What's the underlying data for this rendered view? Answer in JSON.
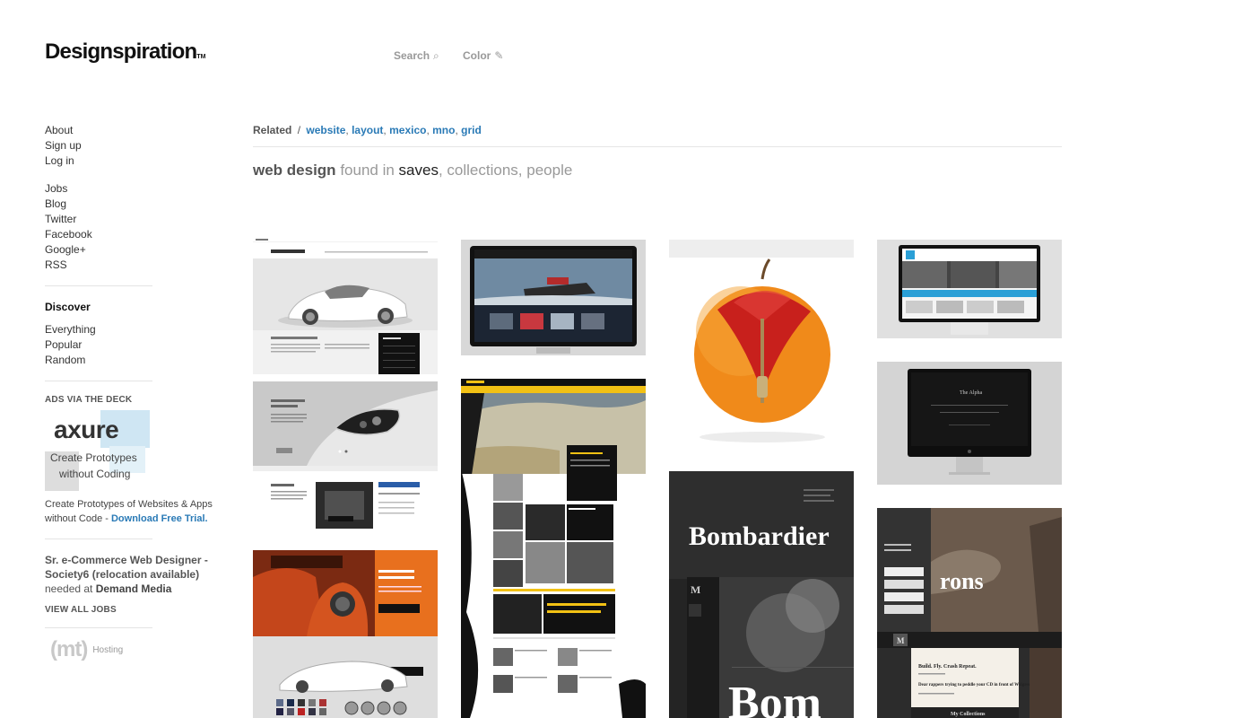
{
  "logo": {
    "text": "Designspiration",
    "tm": "TM"
  },
  "topnav": {
    "search": {
      "label": "Search",
      "icon": "search-icon"
    },
    "color": {
      "label": "Color",
      "icon": "eyedropper-icon"
    }
  },
  "sidebar": {
    "account": [
      "About",
      "Sign up",
      "Log in"
    ],
    "social": [
      "Jobs",
      "Blog",
      "Twitter",
      "Facebook",
      "Google+",
      "RSS"
    ],
    "discover_title": "Discover",
    "discover": [
      "Everything",
      "Popular",
      "Random"
    ],
    "ads_title": "ADS VIA THE DECK",
    "ad": {
      "logo_text": "axure",
      "tagline_1": "Create Prototypes",
      "tagline_2": "without Coding",
      "copy": "Create Prototypes of Websites & Apps without Code - ",
      "link": "Download Free Trial."
    },
    "job": {
      "title": "Sr. e-Commerce Web Designer - Society6 (relocation available)",
      "needed": "needed at ",
      "company": "Demand Media",
      "view_all": "VIEW ALL JOBS"
    },
    "hosting": {
      "logo_text": "(mt)",
      "label": "Hosting"
    }
  },
  "related": {
    "label": "Related",
    "separator": "/",
    "tags": [
      "website",
      "layout",
      "mexico",
      "mno",
      "grid"
    ]
  },
  "results_heading": {
    "query": "web design",
    "found_in": "found in",
    "saves": "saves",
    "collections": "collections",
    "people": "people"
  },
  "tiles": {
    "col1": [
      {
        "subject": "Spyker car website",
        "texts": [
          "SPYKER C8 AILERON",
          "NAVIGATE"
        ]
      },
      {
        "subject": "Spyker headlight page",
        "texts": [
          "EYE-CATCHING HEADLIGHTS",
          "V8 POWER",
          "300",
          "4.5",
          "400"
        ]
      },
      {
        "subject": "Spyker interior page",
        "texts": [
          "WELCOME IN YOUR COCKPIT",
          "NAVIGATE"
        ]
      }
    ],
    "col2": [
      {
        "subject": "Website on monitor with ship image"
      },
      {
        "subject": "Summer collection surf website",
        "texts": [
          "NEW WINTER 2012 WETSUITS COLLECTION"
        ]
      }
    ],
    "col3": [
      {
        "subject": "Zipped orange apple"
      },
      {
        "subject": "Bombardier website",
        "texts": [
          "Bombardier",
          "M",
          "Bom"
        ]
      }
    ],
    "col4": [
      {
        "subject": "Cycling website on iMac",
        "texts": [
          "PERFORMANCE CYCLING COACHING TAILORED TO THE INDIVIDUAL"
        ]
      },
      {
        "subject": "Dark website on iMac",
        "texts": [
          "The Alpha"
        ]
      },
      {
        "subject": "Herons tablet app",
        "texts": [
          "rons",
          "M",
          "Build. Fly. Crash Repeat.",
          "Dear rappers trying to peddle your CD in front of Walgreens",
          "My Collections"
        ]
      }
    ]
  }
}
